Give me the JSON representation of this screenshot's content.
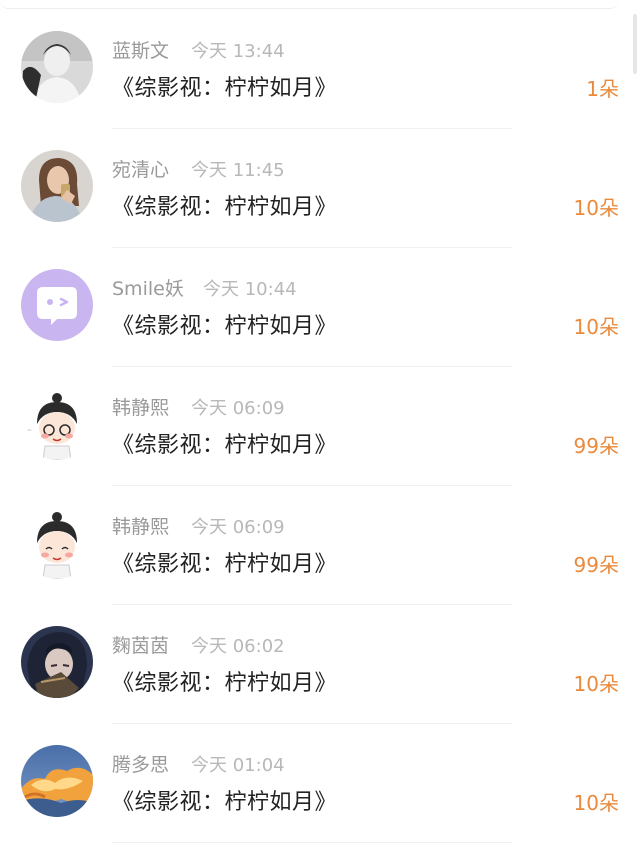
{
  "records": [
    {
      "name": "蓝斯文",
      "time": "今天 13:44",
      "title": "《综影视：柠柠如月》",
      "count": "1朵",
      "avatar": "avatar-bw-boy"
    },
    {
      "name": "宛清心",
      "time": "今天 11:45",
      "title": "《综影视：柠柠如月》",
      "count": "10朵",
      "avatar": "avatar-girl-photo"
    },
    {
      "name": "Smile妖",
      "time": "今天 10:44",
      "title": "《综影视：柠柠如月》",
      "count": "10朵",
      "avatar": "avatar-purple-chat"
    },
    {
      "name": "韩静熙",
      "time": "今天 06:09",
      "title": "《综影视：柠柠如月》",
      "count": "99朵",
      "avatar": "avatar-cartoon-girl"
    },
    {
      "name": "韩静熙",
      "time": "今天 06:09",
      "title": "《综影视：柠柠如月》",
      "count": "99朵",
      "avatar": "avatar-cartoon-girl"
    },
    {
      "name": "麴茵茵",
      "time": "今天 06:02",
      "title": "《综影视：柠柠如月》",
      "count": "10朵",
      "avatar": "avatar-anime-dark"
    },
    {
      "name": "腾多思",
      "time": "今天 01:04",
      "title": "《综影视：柠柠如月》",
      "count": "10朵",
      "avatar": "avatar-sunset-clouds"
    }
  ],
  "colors": {
    "accent": "#ea8a3c",
    "name": "#9a9a9a",
    "time": "#b8b8b8",
    "title": "#222222",
    "avatar_purple": "#c9b6f0"
  }
}
